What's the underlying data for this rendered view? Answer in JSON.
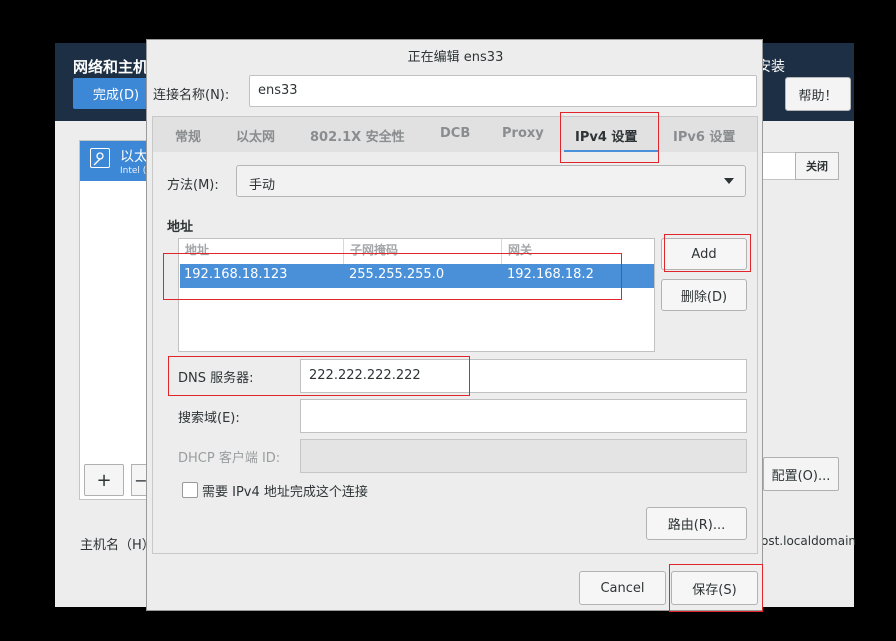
{
  "background": {
    "header_title": "网络和主机",
    "install_label": "安装",
    "done_button": "完成(D)",
    "help_button": "帮助！",
    "interface_name": "以太",
    "interface_sub": "Intel (",
    "add_symbol": "+",
    "remove_symbol": "−",
    "close_button": "关闭",
    "config_button": "配置(O)...",
    "hostname_label": "主机名（H）",
    "hostname_value": "ost.localdomain"
  },
  "dialog": {
    "title": "正在编辑 ens33",
    "connection_label": "连接名称(N):",
    "connection_value": "ens33",
    "tabs": [
      "常规",
      "以太网",
      "802.1X 安全性",
      "DCB",
      "Proxy",
      "IPv4 设置",
      "IPv6 设置"
    ],
    "active_tab": "IPv4 设置",
    "method_label": "方法(M):",
    "method_value": "手动",
    "address_heading": "地址",
    "table_headers": [
      "地址",
      "子网掩码",
      "网关"
    ],
    "rows": [
      {
        "address": "192.168.18.123",
        "netmask": "255.255.255.0",
        "gateway": "192.168.18.2"
      }
    ],
    "add_button": "Add",
    "delete_button": "删除(D)",
    "dns_label": "DNS 服务器:",
    "dns_value": "222.222.222.222",
    "search_label": "搜索域(E):",
    "search_value": "",
    "dhcp_label": "DHCP 客户端 ID:",
    "dhcp_value": "",
    "require_checkbox_label": "需要 IPv4 地址完成这个连接",
    "require_checked": false,
    "routes_button": "路由(R)...",
    "cancel_button": "Cancel",
    "save_button": "保存(S)"
  },
  "colors": {
    "header_bg": "#1c2f44",
    "accent": "#4a90d9",
    "annotation": "#e0262a"
  }
}
